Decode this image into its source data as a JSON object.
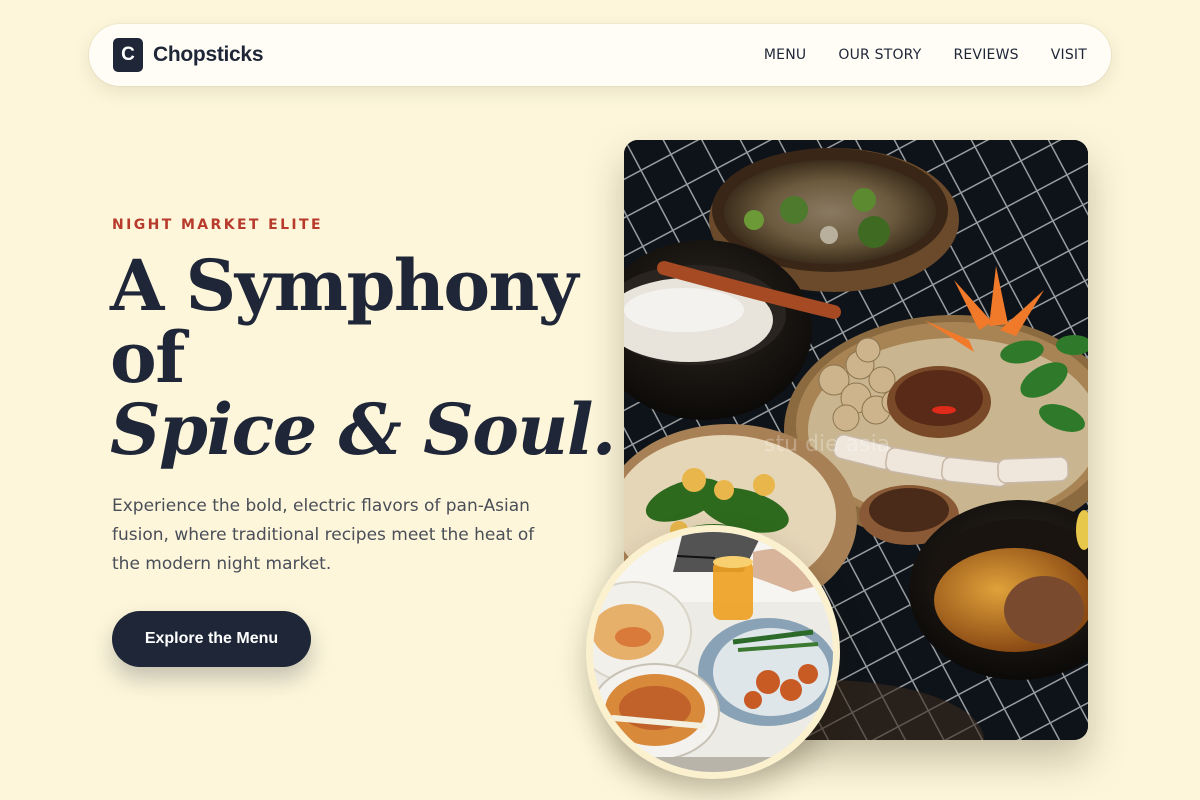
{
  "nav": {
    "logo_letter": "C",
    "brand": "Chopsticks",
    "links": [
      "MENU",
      "OUR STORY",
      "REVIEWS",
      "VISIT"
    ]
  },
  "hero": {
    "eyebrow": "NIGHT MARKET ELITE",
    "headline_line1": "A Symphony",
    "headline_line2": "of",
    "headline_line3": "Spice & Soul.",
    "lead": "Experience the bold, electric flavors of pan-Asian fusion, where traditional recipes meet the heat of the modern night market.",
    "cta": "Explore the Menu"
  },
  "images": {
    "main_watermark": "stu    die asia"
  },
  "colors": {
    "background": "#fdf6da",
    "navy": "#1e2638",
    "accent_red": "#b83a2c"
  }
}
